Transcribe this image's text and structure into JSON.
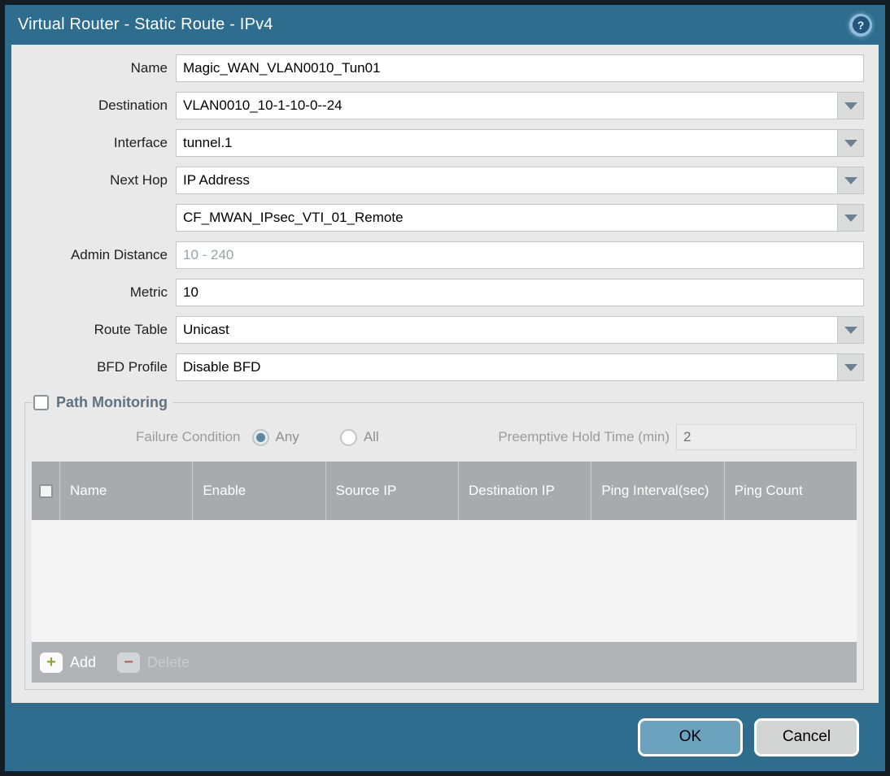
{
  "dialog": {
    "title": "Virtual Router - Static Route - IPv4",
    "help_icon": "?"
  },
  "form": {
    "name": {
      "label": "Name",
      "value": "Magic_WAN_VLAN0010_Tun01"
    },
    "destination": {
      "label": "Destination",
      "value": "VLAN0010_10-1-10-0--24"
    },
    "interface": {
      "label": "Interface",
      "value": "tunnel.1"
    },
    "next_hop": {
      "label": "Next Hop",
      "value": "IP Address"
    },
    "next_hop_address": {
      "value": "CF_MWAN_IPsec_VTI_01_Remote"
    },
    "admin_distance": {
      "label": "Admin Distance",
      "placeholder": "10 - 240",
      "value": ""
    },
    "metric": {
      "label": "Metric",
      "value": "10"
    },
    "route_table": {
      "label": "Route Table",
      "value": "Unicast"
    },
    "bfd_profile": {
      "label": "BFD Profile",
      "value": "Disable BFD"
    }
  },
  "path_monitoring": {
    "label": "Path Monitoring",
    "checked": false,
    "failure_condition": {
      "label": "Failure Condition",
      "options": [
        {
          "label": "Any",
          "selected": true
        },
        {
          "label": "All",
          "selected": false
        }
      ]
    },
    "preemptive_hold_time": {
      "label": "Preemptive Hold Time (min)",
      "value": "2"
    },
    "table": {
      "columns": [
        "Name",
        "Enable",
        "Source IP",
        "Destination IP",
        "Ping Interval(sec)",
        "Ping Count"
      ],
      "rows": []
    },
    "actions": {
      "add": "Add",
      "delete": "Delete",
      "delete_enabled": false
    }
  },
  "footer": {
    "ok": "OK",
    "cancel": "Cancel"
  },
  "colors": {
    "frame_teal": "#2e6d8d",
    "outer_border": "#141c24",
    "panel_gray": "#e9e9e9",
    "table_header_gray": "#a8abae",
    "ok_button_blue": "#6ba2be",
    "add_plus_green": "#89a73d",
    "delete_minus_red": "#aa6a5b",
    "pm_title_slate": "#5e7280"
  }
}
